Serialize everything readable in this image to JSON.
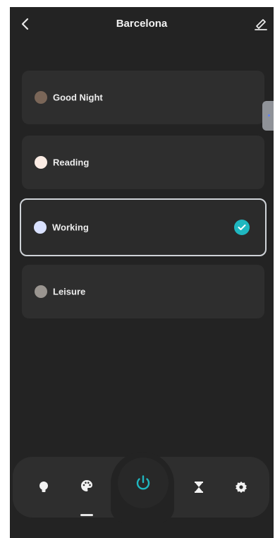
{
  "header": {
    "title": "Barcelona"
  },
  "scenes": [
    {
      "label": "Good Night",
      "dot_color": "#7a6658",
      "selected": false
    },
    {
      "label": "Reading",
      "dot_color": "#fbece4",
      "selected": false
    },
    {
      "label": "Working",
      "dot_color": "#d9e1ff",
      "selected": true
    },
    {
      "label": "Leisure",
      "dot_color": "#9a9590",
      "selected": false
    }
  ],
  "bottom_nav": {
    "items": [
      {
        "icon": "bulb-icon"
      },
      {
        "icon": "palette-icon",
        "active": true
      },
      {
        "icon": "power-icon"
      },
      {
        "icon": "hourglass-icon"
      },
      {
        "icon": "gear-icon"
      }
    ]
  },
  "colors": {
    "background": "#232323",
    "card": "#2e2e2e",
    "accent": "#1fb7c0",
    "selected_border": "#cfd3d8"
  }
}
